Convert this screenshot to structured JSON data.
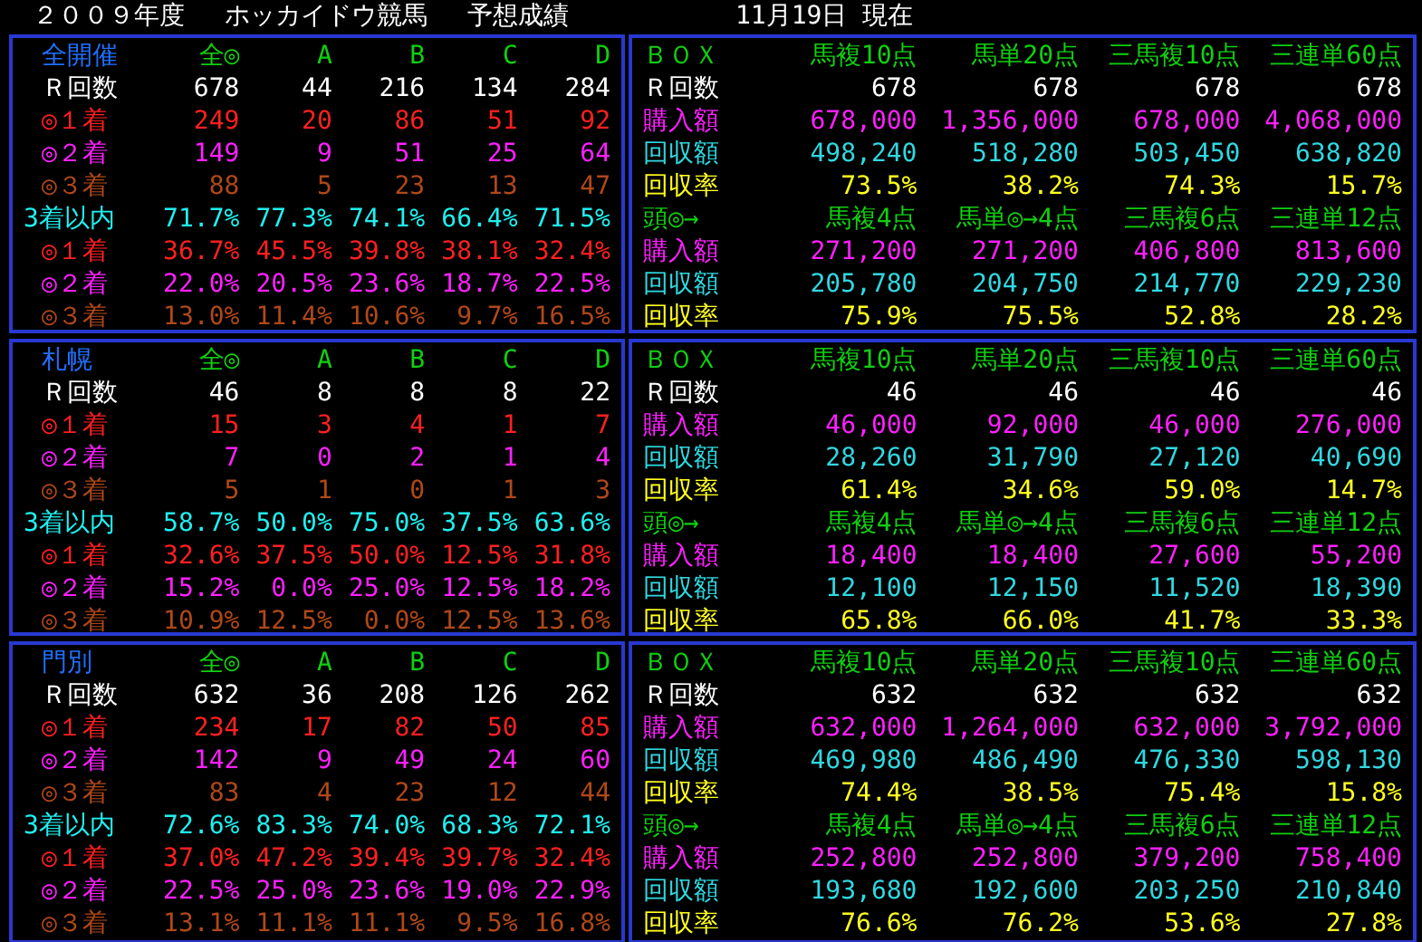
{
  "title": {
    "season": "２００９年度",
    "organizer": "ホッカイドウ競馬",
    "subject": "予想成績",
    "date": "11月19日 現在"
  },
  "sections": [
    {
      "results": {
        "rows": [
          {
            "kind": "header",
            "label": "全開催",
            "values": [
              "全◎",
              "A",
              "B",
              "C",
              "D"
            ]
          },
          {
            "kind": "count",
            "label": "Ｒ回数",
            "values": [
              "678",
              "44",
              "216",
              "134",
              "284"
            ]
          },
          {
            "kind": "first",
            "label": "◎１着",
            "values": [
              "249",
              "20",
              "86",
              "51",
              "92"
            ]
          },
          {
            "kind": "second",
            "label": "◎２着",
            "values": [
              "149",
              "9",
              "51",
              "25",
              "64"
            ]
          },
          {
            "kind": "third",
            "label": "◎３着",
            "values": [
              "88",
              "5",
              "23",
              "13",
              "47"
            ]
          },
          {
            "kind": "top3",
            "label": "3着以内",
            "values": [
              "71.7%",
              "77.3%",
              "74.1%",
              "66.4%",
              "71.5%"
            ]
          },
          {
            "kind": "first",
            "label": "◎１着",
            "values": [
              "36.7%",
              "45.5%",
              "39.8%",
              "38.1%",
              "32.4%"
            ]
          },
          {
            "kind": "second",
            "label": "◎２着",
            "values": [
              "22.0%",
              "20.5%",
              "23.6%",
              "18.7%",
              "22.5%"
            ]
          },
          {
            "kind": "third",
            "label": "◎３着",
            "values": [
              "13.0%",
              "11.4%",
              "10.6%",
              "9.7%",
              "16.5%"
            ]
          }
        ]
      },
      "bets": {
        "rows": [
          {
            "kind": "header",
            "label": "ＢＯＸ",
            "values": [
              "馬複10点",
              "馬単20点",
              "三馬複10点",
              "三連単60点"
            ]
          },
          {
            "kind": "count",
            "label": "Ｒ回数",
            "values": [
              "678",
              "678",
              "678",
              "678"
            ]
          },
          {
            "kind": "buy",
            "label": "購入額",
            "values": [
              "678,000",
              "1,356,000",
              "678,000",
              "4,068,000"
            ]
          },
          {
            "kind": "return",
            "label": "回収額",
            "values": [
              "498,240",
              "518,280",
              "503,450",
              "638,820"
            ]
          },
          {
            "kind": "rate",
            "label": "回収率",
            "values": [
              "73.5%",
              "38.2%",
              "74.3%",
              "15.7%"
            ]
          },
          {
            "kind": "header",
            "label": "頭◎→",
            "values": [
              "馬複4点",
              "馬単◎→4点",
              "三馬複6点",
              "三連単12点"
            ]
          },
          {
            "kind": "buy",
            "label": "購入額",
            "values": [
              "271,200",
              "271,200",
              "406,800",
              "813,600"
            ]
          },
          {
            "kind": "return",
            "label": "回収額",
            "values": [
              "205,780",
              "204,750",
              "214,770",
              "229,230"
            ]
          },
          {
            "kind": "rate",
            "label": "回収率",
            "values": [
              "75.9%",
              "75.5%",
              "52.8%",
              "28.2%"
            ]
          }
        ]
      }
    },
    {
      "results": {
        "rows": [
          {
            "kind": "header",
            "label": "札幌",
            "values": [
              "全◎",
              "A",
              "B",
              "C",
              "D"
            ]
          },
          {
            "kind": "count",
            "label": "Ｒ回数",
            "values": [
              "46",
              "8",
              "8",
              "8",
              "22"
            ]
          },
          {
            "kind": "first",
            "label": "◎１着",
            "values": [
              "15",
              "3",
              "4",
              "1",
              "7"
            ]
          },
          {
            "kind": "second",
            "label": "◎２着",
            "values": [
              "7",
              "0",
              "2",
              "1",
              "4"
            ]
          },
          {
            "kind": "third",
            "label": "◎３着",
            "values": [
              "5",
              "1",
              "0",
              "1",
              "3"
            ]
          },
          {
            "kind": "top3",
            "label": "3着以内",
            "values": [
              "58.7%",
              "50.0%",
              "75.0%",
              "37.5%",
              "63.6%"
            ]
          },
          {
            "kind": "first",
            "label": "◎１着",
            "values": [
              "32.6%",
              "37.5%",
              "50.0%",
              "12.5%",
              "31.8%"
            ]
          },
          {
            "kind": "second",
            "label": "◎２着",
            "values": [
              "15.2%",
              "0.0%",
              "25.0%",
              "12.5%",
              "18.2%"
            ]
          },
          {
            "kind": "third",
            "label": "◎３着",
            "values": [
              "10.9%",
              "12.5%",
              "0.0%",
              "12.5%",
              "13.6%"
            ]
          }
        ]
      },
      "bets": {
        "rows": [
          {
            "kind": "header",
            "label": "ＢＯＸ",
            "values": [
              "馬複10点",
              "馬単20点",
              "三馬複10点",
              "三連単60点"
            ]
          },
          {
            "kind": "count",
            "label": "Ｒ回数",
            "values": [
              "46",
              "46",
              "46",
              "46"
            ]
          },
          {
            "kind": "buy",
            "label": "購入額",
            "values": [
              "46,000",
              "92,000",
              "46,000",
              "276,000"
            ]
          },
          {
            "kind": "return",
            "label": "回収額",
            "values": [
              "28,260",
              "31,790",
              "27,120",
              "40,690"
            ]
          },
          {
            "kind": "rate",
            "label": "回収率",
            "values": [
              "61.4%",
              "34.6%",
              "59.0%",
              "14.7%"
            ]
          },
          {
            "kind": "header",
            "label": "頭◎→",
            "values": [
              "馬複4点",
              "馬単◎→4点",
              "三馬複6点",
              "三連単12点"
            ]
          },
          {
            "kind": "buy",
            "label": "購入額",
            "values": [
              "18,400",
              "18,400",
              "27,600",
              "55,200"
            ]
          },
          {
            "kind": "return",
            "label": "回収額",
            "values": [
              "12,100",
              "12,150",
              "11,520",
              "18,390"
            ]
          },
          {
            "kind": "rate",
            "label": "回収率",
            "values": [
              "65.8%",
              "66.0%",
              "41.7%",
              "33.3%"
            ]
          }
        ]
      }
    },
    {
      "results": {
        "rows": [
          {
            "kind": "header",
            "label": "門別",
            "values": [
              "全◎",
              "A",
              "B",
              "C",
              "D"
            ]
          },
          {
            "kind": "count",
            "label": "Ｒ回数",
            "values": [
              "632",
              "36",
              "208",
              "126",
              "262"
            ]
          },
          {
            "kind": "first",
            "label": "◎１着",
            "values": [
              "234",
              "17",
              "82",
              "50",
              "85"
            ]
          },
          {
            "kind": "second",
            "label": "◎２着",
            "values": [
              "142",
              "9",
              "49",
              "24",
              "60"
            ]
          },
          {
            "kind": "third",
            "label": "◎３着",
            "values": [
              "83",
              "4",
              "23",
              "12",
              "44"
            ]
          },
          {
            "kind": "top3",
            "label": "3着以内",
            "values": [
              "72.6%",
              "83.3%",
              "74.0%",
              "68.3%",
              "72.1%"
            ]
          },
          {
            "kind": "first",
            "label": "◎１着",
            "values": [
              "37.0%",
              "47.2%",
              "39.4%",
              "39.7%",
              "32.4%"
            ]
          },
          {
            "kind": "second",
            "label": "◎２着",
            "values": [
              "22.5%",
              "25.0%",
              "23.6%",
              "19.0%",
              "22.9%"
            ]
          },
          {
            "kind": "third",
            "label": "◎３着",
            "values": [
              "13.1%",
              "11.1%",
              "11.1%",
              "9.5%",
              "16.8%"
            ]
          }
        ]
      },
      "bets": {
        "rows": [
          {
            "kind": "header",
            "label": "ＢＯＸ",
            "values": [
              "馬複10点",
              "馬単20点",
              "三馬複10点",
              "三連単60点"
            ]
          },
          {
            "kind": "count",
            "label": "Ｒ回数",
            "values": [
              "632",
              "632",
              "632",
              "632"
            ]
          },
          {
            "kind": "buy",
            "label": "購入額",
            "values": [
              "632,000",
              "1,264,000",
              "632,000",
              "3,792,000"
            ]
          },
          {
            "kind": "return",
            "label": "回収額",
            "values": [
              "469,980",
              "486,490",
              "476,330",
              "598,130"
            ]
          },
          {
            "kind": "rate",
            "label": "回収率",
            "values": [
              "74.4%",
              "38.5%",
              "75.4%",
              "15.8%"
            ]
          },
          {
            "kind": "header",
            "label": "頭◎→",
            "values": [
              "馬複4点",
              "馬単◎→4点",
              "三馬複6点",
              "三連単12点"
            ]
          },
          {
            "kind": "buy",
            "label": "購入額",
            "values": [
              "252,800",
              "252,800",
              "379,200",
              "758,400"
            ]
          },
          {
            "kind": "return",
            "label": "回収額",
            "values": [
              "193,680",
              "192,600",
              "203,250",
              "210,840"
            ]
          },
          {
            "kind": "rate",
            "label": "回収率",
            "values": [
              "76.6%",
              "76.2%",
              "53.6%",
              "27.8%"
            ]
          }
        ]
      }
    }
  ]
}
